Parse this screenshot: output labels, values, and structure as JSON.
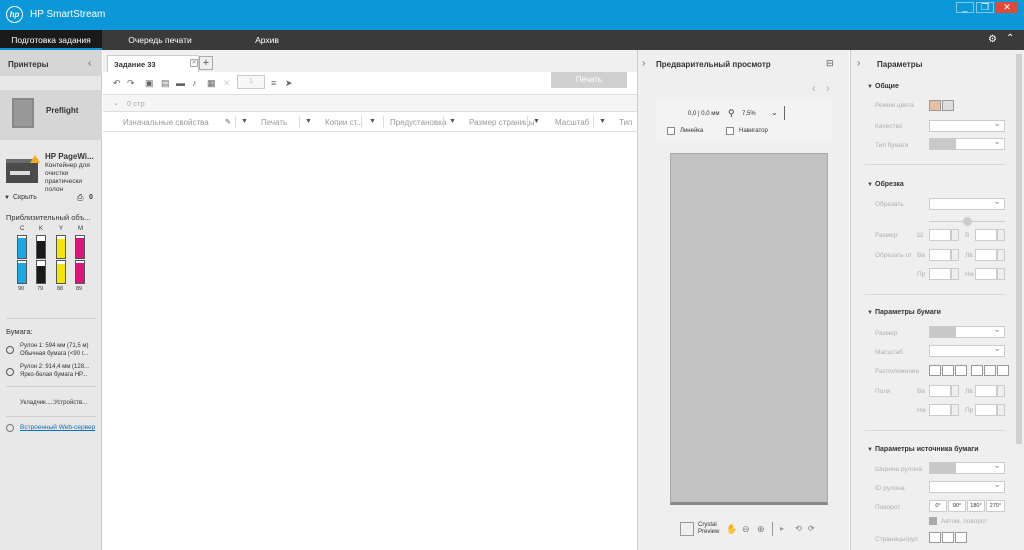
{
  "app": {
    "logo": "hp",
    "title": "HP SmartStream",
    "window_buttons": [
      "_",
      "❐",
      "✕"
    ]
  },
  "menu": {
    "items": [
      "Подготовка задания",
      "Очередь печати",
      "Архив"
    ]
  },
  "left_panel": {
    "title": "Принтеры",
    "preflight": "Preflight",
    "printer": {
      "name": "HP PageWi...",
      "status_lines": [
        "Контейнер для",
        "очистки",
        "практически",
        "полон"
      ]
    },
    "hide_label": "Скрыть",
    "count": "0",
    "ink_title": "Приблизительный объ...",
    "inks": [
      {
        "label": "C",
        "level": "90",
        "color": "#1aa9e0",
        "fill": 0.9
      },
      {
        "label": "K",
        "level": "79",
        "color": "#1a1a1a",
        "fill": 0.79
      },
      {
        "label": "Y",
        "level": "88",
        "color": "#f5e800",
        "fill": 0.88
      },
      {
        "label": "M",
        "level": "89",
        "color": "#e0137c",
        "fill": 0.89
      }
    ],
    "paper_title": "Бумага:",
    "rolls": [
      {
        "num": "1",
        "line1": "Рулон 1: 594 мм (71,5 м)",
        "line2": "Обычная бумага (<90 г..."
      },
      {
        "num": "2",
        "line1": "Рулон 2: 914,4 мм (128...",
        "line2": "Ярко-белая бумага HP..."
      }
    ],
    "stacker": "Укладчик....:Устройств...",
    "web_server": "Встроенный Web-сервер"
  },
  "job": {
    "tab_label": "Задание 33",
    "tab_close": "✕",
    "add_tab": "+",
    "copies": "1",
    "print_button": "Печать",
    "page_count": "0 стр",
    "columns": [
      "Изначальные свойства",
      "Печать",
      "Копии ст...",
      "Предустановка",
      "Размер страницы",
      "Масштаб",
      "Тип"
    ]
  },
  "preview": {
    "title": "Предварительный просмотр",
    "coords": "0,0 | 0,0 мм",
    "zoom": "7,5%",
    "ruler_label": "Линейка",
    "navigator_label": "Навигатор",
    "crystal_preview": "Crystal Preview"
  },
  "params": {
    "title": "Параметры",
    "general": "Общие",
    "color_mode": "Режим цвета",
    "quality": "Качество",
    "paper_type": "Тип бумаги",
    "trim": "Обрезка",
    "trim_label": "Обрезать",
    "size_label": "Размер",
    "w": "Ш",
    "h": "В",
    "trim_from": "Обрезать от",
    "top": "Вв",
    "left": "Лв",
    "right": "Пр",
    "bottom": "Нж",
    "paper_params": "Параметры бумаги",
    "p_size": "Размер",
    "scale": "Масштаб",
    "align": "Расположение",
    "fields": "Поля",
    "source": "Параметры источника бумаги",
    "roll_width": "Ширина рулона",
    "roll_id": "ID рулона",
    "rotate": "Поворот",
    "rotations": [
      "0°",
      "90°",
      "180°",
      "270°"
    ],
    "auto_rotate": "Автом. поворот",
    "pages": "Страницы/рул"
  }
}
